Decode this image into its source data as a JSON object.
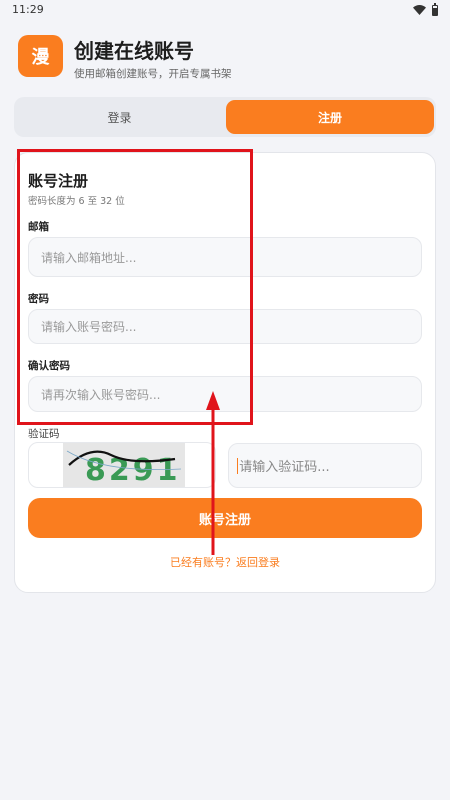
{
  "status_bar": {
    "time": "11:29",
    "icons": [
      "wifi-icon",
      "battery-icon"
    ]
  },
  "header": {
    "logo_char": "漫",
    "title": "创建在线账号",
    "subtitle": "使用邮箱创建账号，开启专属书架"
  },
  "tabs": [
    {
      "label": "登录",
      "active": false
    },
    {
      "label": "注册",
      "active": true
    }
  ],
  "form": {
    "title": "账号注册",
    "hint": "密码长度为 6 至 32 位",
    "email": {
      "label": "邮箱",
      "placeholder": "请输入邮箱地址..."
    },
    "password": {
      "label": "密码",
      "placeholder": "请输入账号密码..."
    },
    "confirm_password": {
      "label": "确认密码",
      "placeholder": "请再次输入账号密码..."
    },
    "captcha": {
      "label": "验证码",
      "image_text": "8291",
      "placeholder": "请输入验证码..."
    },
    "submit_label": "账号注册",
    "login_link": "已经有账号？返回登录"
  },
  "colors": {
    "accent": "#fa7d1f",
    "annotation": "#e0141b",
    "background": "#f3f4f8"
  }
}
